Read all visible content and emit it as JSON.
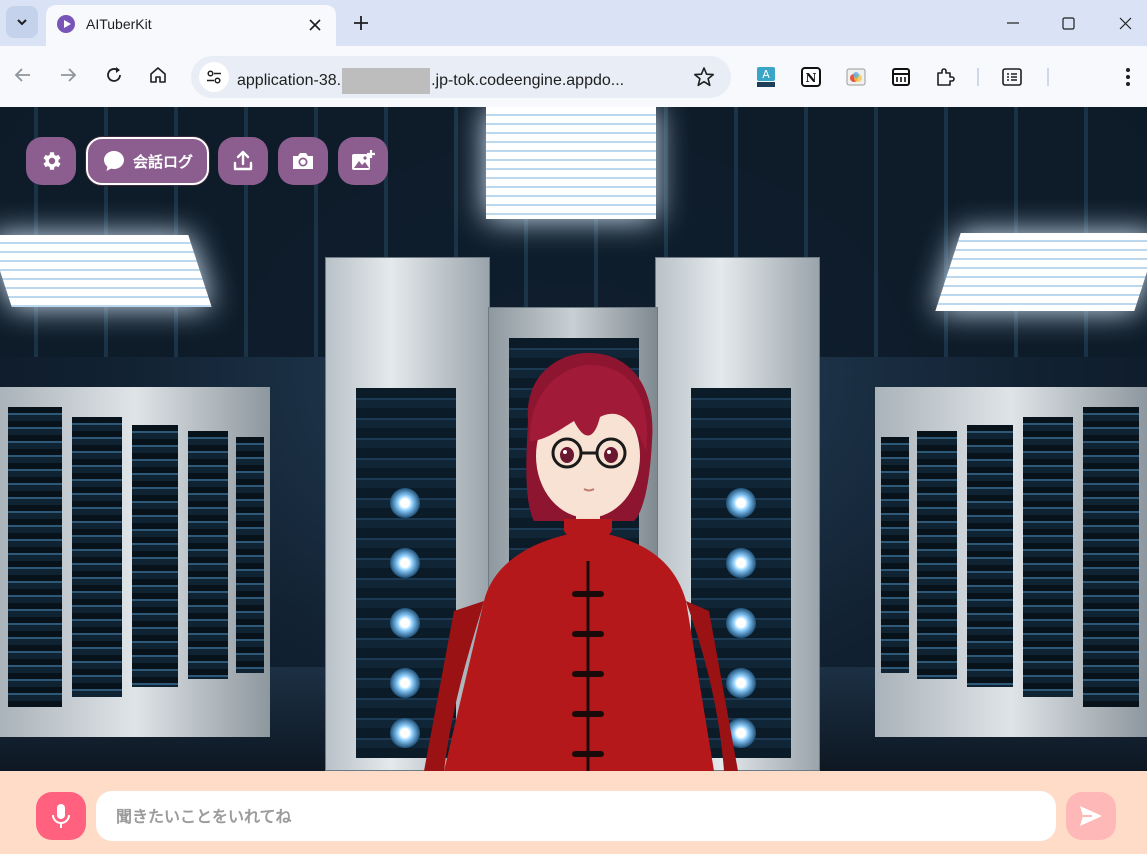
{
  "browser": {
    "tab_title": "AITuberKit",
    "url_prefix": "application-38.",
    "url_suffix": ".jp-tok.codeengine.appdo..."
  },
  "app": {
    "chat_log_label": "会話ログ",
    "input_placeholder": "聞きたいことをいれてね",
    "colors": {
      "overlay_button": "#8b5e8f",
      "mic_button": "#ff617f",
      "send_button": "#ffb8b8",
      "bottom_bar": "#fedcc7"
    }
  },
  "icons": {
    "settings": "gear-icon",
    "chat_log": "speech-bubble-icon",
    "share": "upload-icon",
    "camera": "camera-icon",
    "image": "add-image-icon",
    "mic": "microphone-icon",
    "send": "send-icon"
  }
}
